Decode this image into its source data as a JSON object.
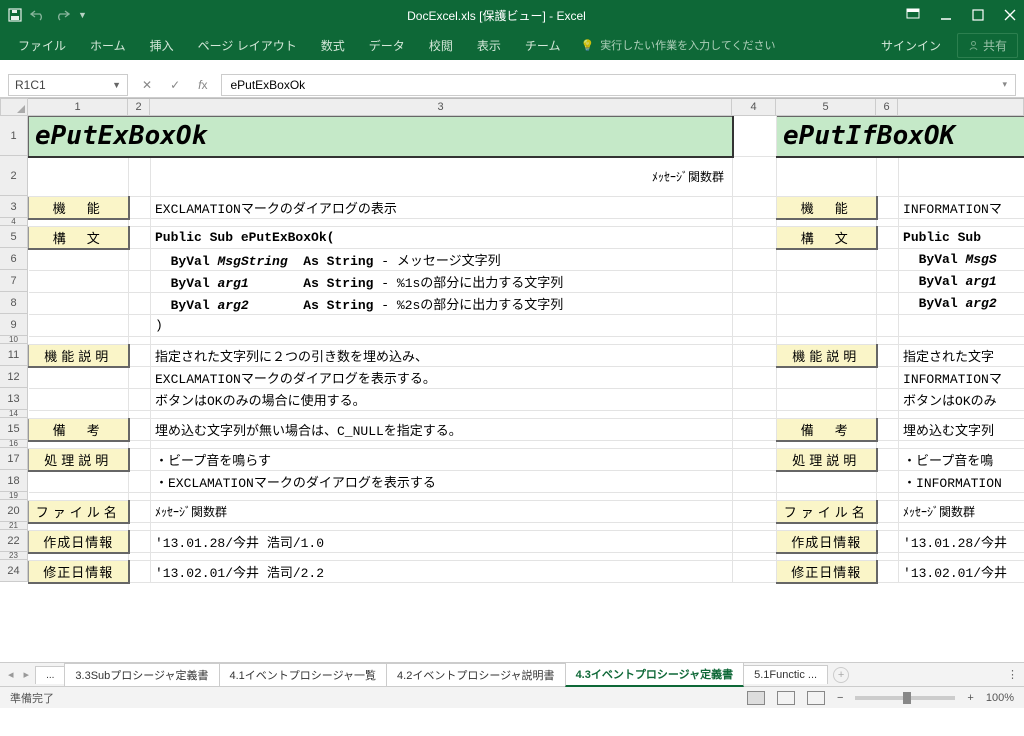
{
  "titlebar": {
    "title": "DocExcel.xls [保護ビュー] - Excel"
  },
  "ribbon": {
    "tabs": [
      "ファイル",
      "ホーム",
      "挿入",
      "ページ レイアウト",
      "数式",
      "データ",
      "校閲",
      "表示",
      "チーム"
    ],
    "tellme": "実行したい作業を入力してください",
    "signin": "サインイン",
    "share": "共有"
  },
  "formula": {
    "namebox": "R1C1",
    "value": "ePutExBoxOk"
  },
  "cols": {
    "c1": "1",
    "c2": "2",
    "c3": "3",
    "c4": "4",
    "c5": "5",
    "c6": "6"
  },
  "rows": [
    "1",
    "2",
    "3",
    "4",
    "5",
    "6",
    "7",
    "8",
    "9",
    "10",
    "11",
    "12",
    "13",
    "14",
    "15",
    "16",
    "17",
    "18",
    "19",
    "20",
    "21",
    "22",
    "23",
    "24"
  ],
  "left": {
    "title": "ePutExBoxOk",
    "subtitle": "ﾒｯｾｰｼﾞ関数群",
    "l_kinou": "機　能",
    "r3": "EXCLAMATIONマークのダイアログの表示",
    "l_koubun": "構　文",
    "r5": "Public Sub ePutExBoxOk(",
    "r6": "  ByVal MsgString  As String - メッセージ文字列",
    "r7": "  ByVal arg1       As String - %1sの部分に出力する文字列",
    "r8": "  ByVal arg2       As String - %2sの部分に出力する文字列",
    "r9": ")",
    "l_setsumei": "機能説明",
    "r11": "指定された文字列に２つの引き数を埋め込み、",
    "r12": "EXCLAMATIONマークのダイアログを表示する。",
    "r13": "ボタンはOKのみの場合に使用する。",
    "l_bikou": "備　考",
    "r15": "埋め込む文字列が無い場合は、C_NULLを指定する。",
    "l_shori": "処理説明",
    "r17": "・ビープ音を鳴らす",
    "r18": "・EXCLAMATIONマークのダイアログを表示する",
    "l_file": "ファイル名",
    "r20": "ﾒｯｾｰｼﾞ関数群",
    "l_sakusei": "作成日情報",
    "r22": "'13.01.28/今井 浩司/1.0",
    "l_shusei": "修正日情報",
    "r24": "'13.02.01/今井 浩司/2.2"
  },
  "right": {
    "title": "ePutIfBoxOK",
    "r3": "INFORMATIONマ",
    "r5": "Public Sub",
    "r6": "  ByVal MsgS",
    "r7": "  ByVal arg1",
    "r8": "  ByVal arg2",
    "r11": "指定された文字",
    "r12": "INFORMATIONマ",
    "r13": "ボタンはOKのみ",
    "r15": "埋め込む文字列",
    "r17": "・ビープ音を鳴",
    "r18": "・INFORMATION",
    "r20": "ﾒｯｾｰｼﾞ関数群",
    "r22": "'13.01.28/今井",
    "r24": "'13.02.01/今井"
  },
  "sheettabs": {
    "t0": "...",
    "t1": "3.3Subプロシージャ定義書",
    "t2": "4.1イベントプロシージャ一覧",
    "t3": "4.2イベントプロシージャ説明書",
    "t4": "4.3イベントプロシージャ定義書",
    "t5": "5.1Functic ..."
  },
  "status": {
    "ready": "準備完了",
    "zoom": "100%"
  }
}
